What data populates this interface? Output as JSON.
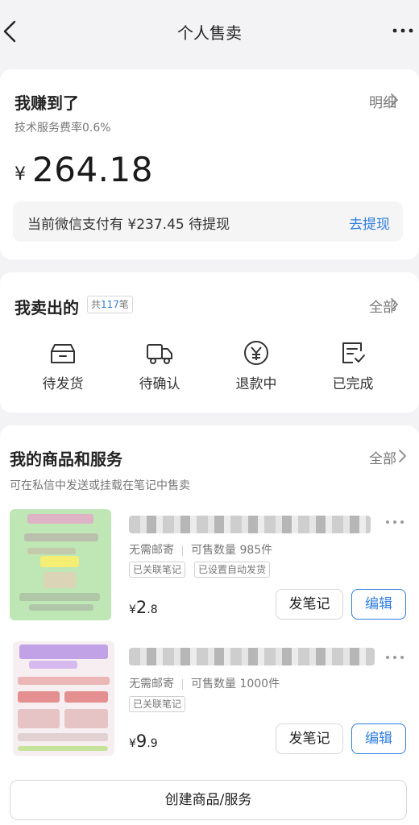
{
  "header": {
    "title": "个人售卖"
  },
  "earnings": {
    "title": "我赚到了",
    "detail_link": "明细",
    "fee_rate": "技术服务费率0.6%",
    "currency": "¥",
    "amount": "264.18",
    "withdraw_text": "当前微信支付有 ¥237.45 待提现",
    "withdraw_button": "去提现"
  },
  "sold": {
    "title": "我卖出的",
    "count_prefix": "共",
    "count": "117",
    "count_suffix": "笔",
    "all_link": "全部",
    "statuses": [
      {
        "label": "待发货",
        "icon": "package-icon"
      },
      {
        "label": "待确认",
        "icon": "truck-icon"
      },
      {
        "label": "退款中",
        "icon": "yen-circle-icon"
      },
      {
        "label": "已完成",
        "icon": "check-note-icon"
      }
    ]
  },
  "goods": {
    "title": "我的商品和服务",
    "all_link": "全部",
    "subtitle": "可在私信中发送或挂载在笔记中售卖",
    "items": [
      {
        "shipping": "无需邮寄",
        "stock_label": "可售数量 985件",
        "tags": [
          "已关联笔记",
          "已设置自动发货"
        ],
        "price_symbol": "¥",
        "price_int": "2",
        "price_dec": ".8",
        "note_button": "发笔记",
        "edit_button": "编辑"
      },
      {
        "shipping": "无需邮寄",
        "stock_label": "可售数量 1000件",
        "tags": [
          "已关联笔记"
        ],
        "price_symbol": "¥",
        "price_int": "9",
        "price_dec": ".9",
        "note_button": "发笔记",
        "edit_button": "编辑"
      }
    ],
    "create_button": "创建商品/服务"
  },
  "colors": {
    "accent": "#2f7de1",
    "background": "#f3f3f5"
  }
}
